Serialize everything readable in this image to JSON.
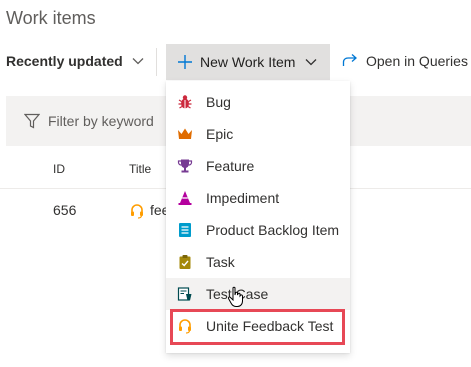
{
  "page": {
    "title": "Work items"
  },
  "toolbar": {
    "recent_label": "Recently updated",
    "new_item_label": "New Work Item",
    "open_queries_label": "Open in Queries"
  },
  "filter": {
    "placeholder": "Filter by keyword"
  },
  "grid": {
    "headers": {
      "id": "ID",
      "title": "Title"
    },
    "rows": [
      {
        "id": "656",
        "title": "fee"
      }
    ]
  },
  "menu": {
    "items": [
      {
        "label": "Bug",
        "icon": "bug-icon",
        "color": "#cc293d"
      },
      {
        "label": "Epic",
        "icon": "crown-icon",
        "color": "#e06c00"
      },
      {
        "label": "Feature",
        "icon": "trophy-icon",
        "color": "#773b93"
      },
      {
        "label": "Impediment",
        "icon": "impediment-icon",
        "color": "#b4009e"
      },
      {
        "label": "Product Backlog Item",
        "icon": "backlog-item-icon",
        "color": "#009ccc"
      },
      {
        "label": "Task",
        "icon": "clipboard-icon",
        "color": "#a4880a"
      },
      {
        "label": "Test Case",
        "icon": "test-case-icon",
        "color": "#004b50"
      },
      {
        "label": "Unite Feedback Test",
        "icon": "headset-icon",
        "color": "#ff9d00"
      }
    ],
    "hovered_item": "Test Case",
    "highlighted_item": "Unite Feedback Test"
  },
  "colors": {
    "highlight_border": "#e74856",
    "button_background": "#e1e0df"
  }
}
